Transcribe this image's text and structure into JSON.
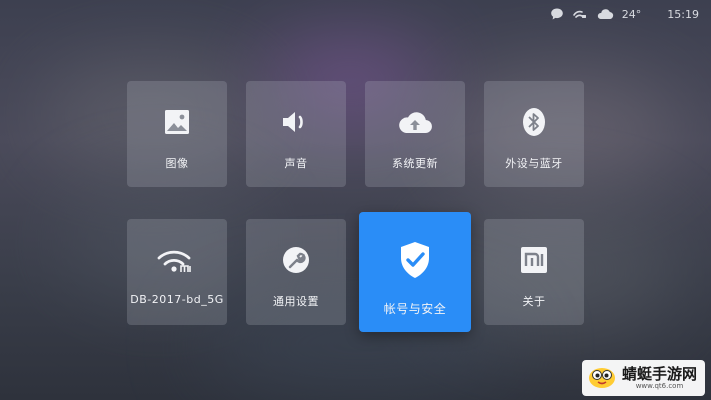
{
  "status": {
    "temperature": "24°",
    "time": "15:19",
    "icons": [
      "chat-icon",
      "link-icon",
      "cloud-icon"
    ]
  },
  "tiles": [
    {
      "label": "图像",
      "icon": "image-icon"
    },
    {
      "label": "声音",
      "icon": "speaker-icon"
    },
    {
      "label": "系统更新",
      "icon": "cloud-upload-icon"
    },
    {
      "label": "外设与蓝牙",
      "icon": "bluetooth-icon"
    },
    {
      "label": "DB-2017-bd_5G",
      "icon": "wifi-mi-icon"
    },
    {
      "label": "通用设置",
      "icon": "wrench-icon"
    },
    {
      "label": "帐号与安全",
      "icon": "shield-check-icon",
      "focused": true
    },
    {
      "label": "关于",
      "icon": "mi-logo-icon"
    }
  ],
  "colors": {
    "focus_accent": "#2a8df7",
    "tile_background": "rgba(190,194,204,0.22)"
  },
  "watermark": {
    "text": "蜻蜓手游网",
    "url": "www.qt6.com"
  }
}
